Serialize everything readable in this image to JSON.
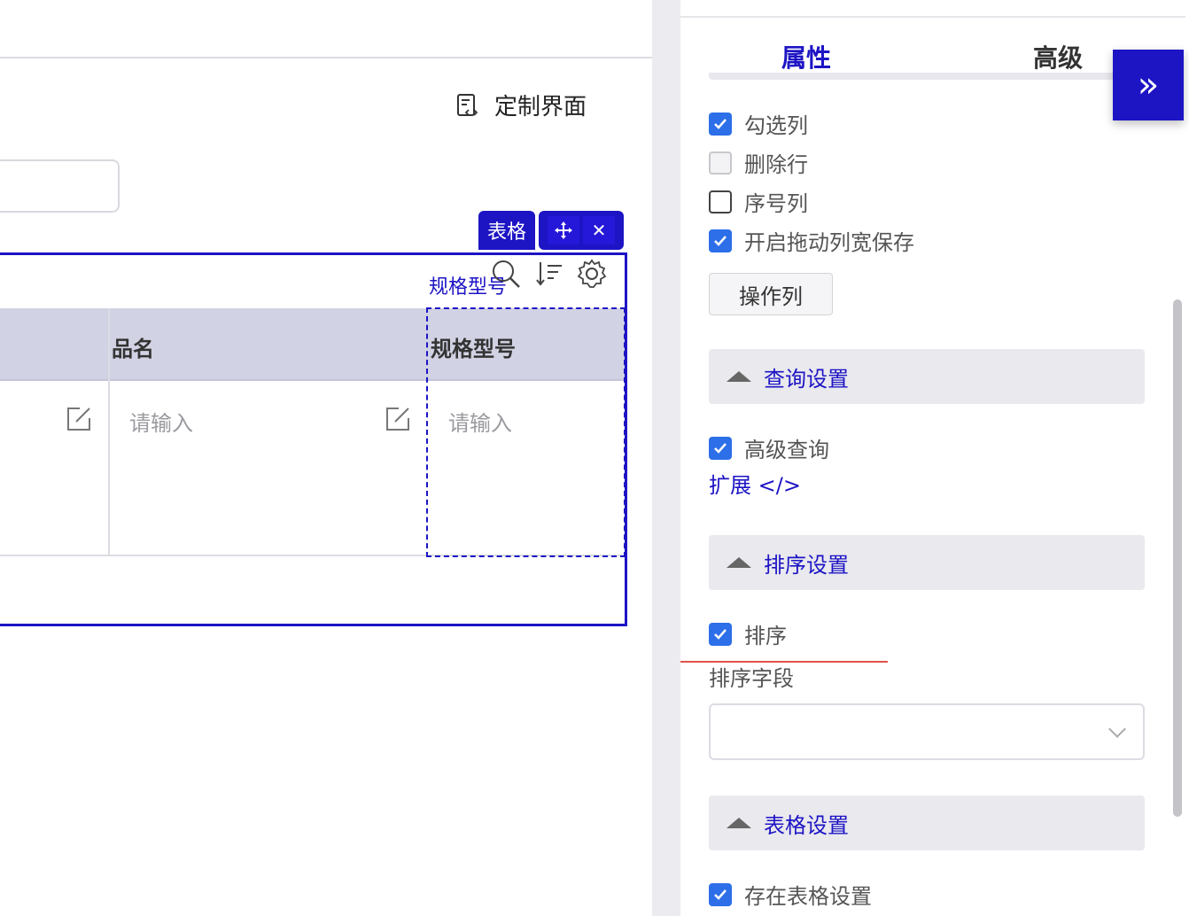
{
  "canvas": {
    "customize_label": "定制界面",
    "table_tag": "表格",
    "toolbar_label": "规格型号",
    "columns": [
      "品名",
      "规格型号"
    ],
    "cell_placeholder": "请输入"
  },
  "panel": {
    "tabs": [
      "属性",
      "高级"
    ],
    "collapse_glyph": "»",
    "checkboxes": [
      {
        "label": "勾选列",
        "checked": true
      },
      {
        "label": "删除行",
        "checked": false,
        "disabled": true
      },
      {
        "label": "序号列",
        "checked": false
      },
      {
        "label": "开启拖动列宽保存",
        "checked": true
      }
    ],
    "op_button": "操作列",
    "query_section": "查询设置",
    "advanced_query": "高级查询",
    "extend_link": "扩展 </>",
    "sort_section": "排序设置",
    "sort_checkbox": "排序",
    "sort_field_label": "排序字段",
    "sort_field_value": "",
    "table_section": "表格设置",
    "table_setting_checkbox": "存在表格设置"
  },
  "colors": {
    "accent": "#1d14c4",
    "checkbox": "#2c6fe8",
    "header_bg": "#d1d2e3",
    "section_bg": "#e9e9ee"
  }
}
